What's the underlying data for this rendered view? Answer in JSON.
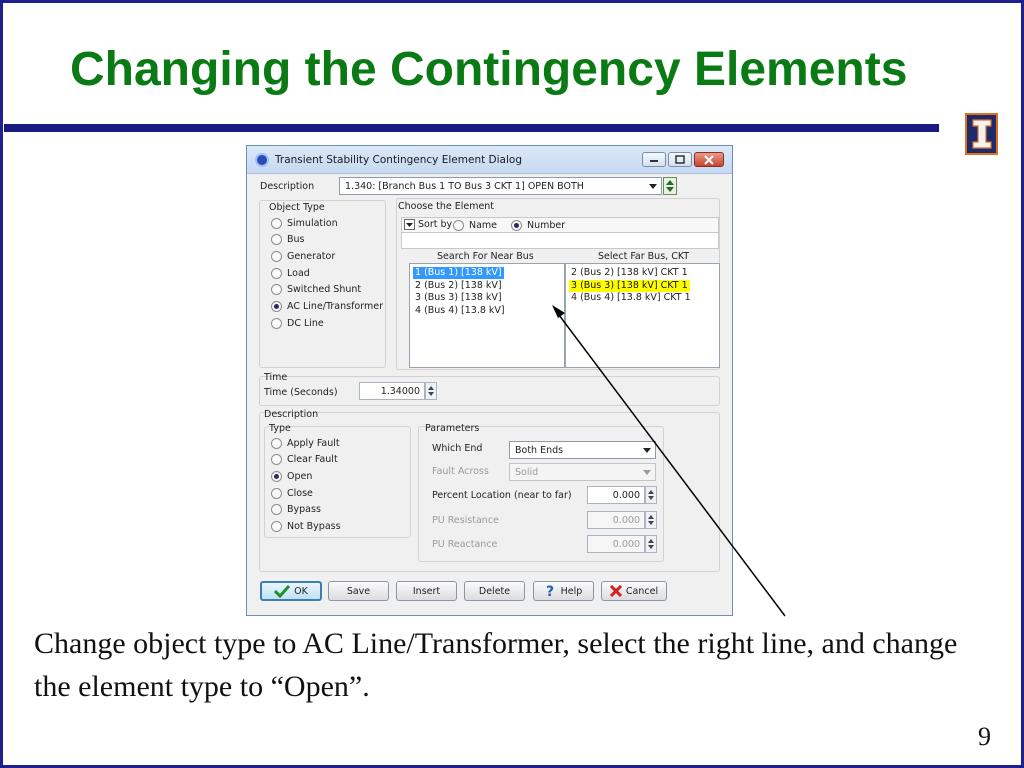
{
  "slide": {
    "title": "Changing the Contingency Elements",
    "caption": "Change object type to AC Line/Transformer, select the right line, and change the element type to “Open”.",
    "page_number": "9"
  },
  "colors": {
    "title_green": "#0a7a14",
    "rule_navy": "#1a1a80",
    "selection_blue": "#3399ff",
    "highlight_yellow": "#ffff00"
  },
  "dialog": {
    "title": "Transient Stability Contingency Element Dialog",
    "description_label": "Description",
    "description_value": "1.340: [Branch Bus 1  TO  Bus 3 CKT 1] OPEN BOTH",
    "object_type": {
      "label": "Object Type",
      "options": [
        "Simulation",
        "Bus",
        "Generator",
        "Load",
        "Switched Shunt",
        "AC Line/Transformer",
        "DC Line"
      ],
      "selected": "AC Line/Transformer"
    },
    "choose_element": {
      "label": "Choose the Element",
      "sort_by_label": "Sort by",
      "sort_options": [
        "Name",
        "Number"
      ],
      "sort_selected": "Number",
      "search_near_label": "Search For Near Bus",
      "select_far_label": "Select Far Bus, CKT",
      "near_buses": [
        "1 (Bus 1)  [138 kV]",
        "2 (Bus 2)  [138 kV]",
        "3 (Bus 3)  [138 kV]",
        "4 (Bus 4)  [13.8 kV]"
      ],
      "near_selected": "1 (Bus 1)  [138 kV]",
      "far_buses": [
        "2 (Bus 2) [138 kV] CKT  1",
        "3 (Bus 3) [138 kV] CKT  1",
        "4 (Bus 4) [13.8 kV] CKT  1"
      ],
      "far_selected": "3 (Bus 3) [138 kV] CKT  1"
    },
    "time": {
      "group_label": "Time",
      "label": "Time (Seconds)",
      "value": "1.34000"
    },
    "desc_group_label": "Description",
    "type": {
      "label": "Type",
      "options": [
        "Apply Fault",
        "Clear Fault",
        "Open",
        "Close",
        "Bypass",
        "Not Bypass"
      ],
      "selected": "Open"
    },
    "parameters": {
      "label": "Parameters",
      "which_end_label": "Which End",
      "which_end_value": "Both Ends",
      "fault_across_label": "Fault Across",
      "fault_across_value": "Solid",
      "percent_location_label": "Percent Location (near to far)",
      "percent_location_value": "0.000",
      "pu_resistance_label": "PU Resistance",
      "pu_resistance_value": "0.000",
      "pu_reactance_label": "PU Reactance",
      "pu_reactance_value": "0.000"
    },
    "buttons": {
      "ok": "OK",
      "save": "Save",
      "insert": "Insert",
      "delete": "Delete",
      "help": "Help",
      "cancel": "Cancel"
    }
  }
}
